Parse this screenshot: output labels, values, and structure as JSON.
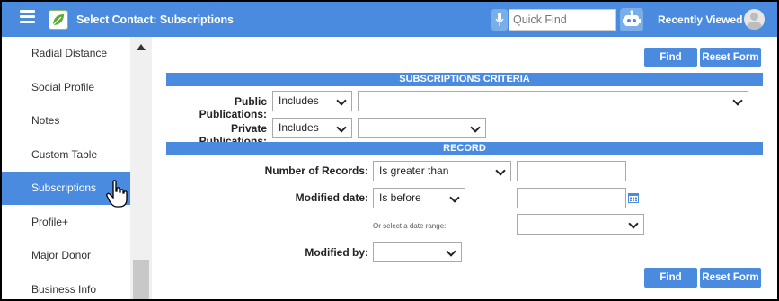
{
  "header": {
    "title": "Select Contact: Subscriptions",
    "quickfind_placeholder": "Quick Find",
    "recently_viewed": "Recently Viewed",
    "caret": "▾"
  },
  "sidebar": {
    "items": [
      {
        "label": "Radial Distance"
      },
      {
        "label": "Social Profile"
      },
      {
        "label": "Notes"
      },
      {
        "label": "Custom Table"
      },
      {
        "label": "Subscriptions",
        "active": true
      },
      {
        "label": "Profile+"
      },
      {
        "label": "Major Donor"
      },
      {
        "label": "Business Info"
      }
    ]
  },
  "buttons": {
    "find": "Find",
    "reset": "Reset Form"
  },
  "criteria": {
    "heading": "SUBSCRIPTIONS CRITERIA",
    "public_label": "Public Publications:",
    "public_op": "Includes",
    "public_value": "",
    "private_label": "Private Publications:",
    "private_op": "Includes",
    "private_value": ""
  },
  "record": {
    "heading": "RECORD",
    "num_records_label": "Number of Records:",
    "num_records_op": "Is greater than",
    "num_records_value": "",
    "modified_date_label": "Modified date:",
    "modified_date_op": "Is before",
    "modified_date_value": "",
    "date_range_note": "Or select a date range:",
    "date_range_value": "",
    "modified_by_label": "Modified by:",
    "modified_by_value": ""
  },
  "colors": {
    "accent": "#4a8be0"
  }
}
